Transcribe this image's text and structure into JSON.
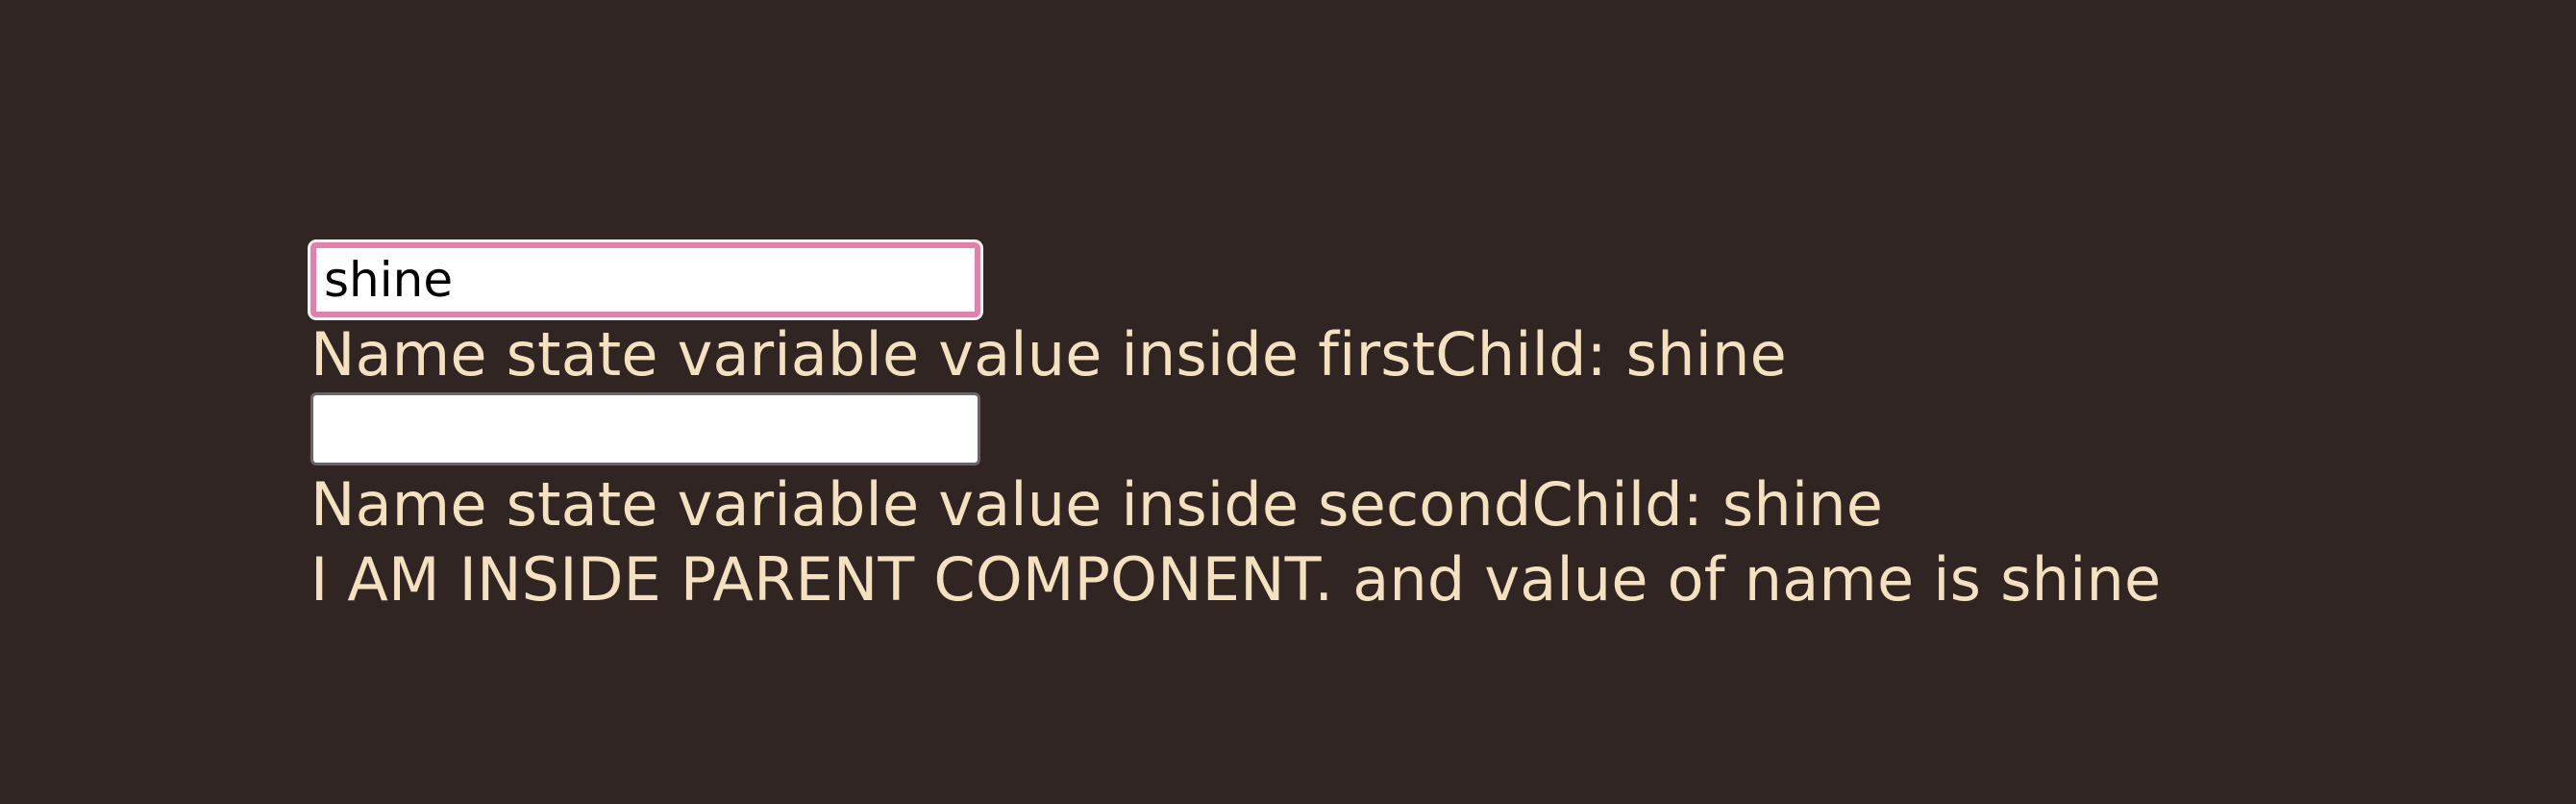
{
  "first_child": {
    "input_value": "shine",
    "label": "Name state variable value inside firstChild: shine"
  },
  "second_child": {
    "input_value": "",
    "label": "Name state variable value inside secondChild: shine"
  },
  "parent": {
    "label": "I AM INSIDE PARENT COMPONENT. and value of name is shine"
  },
  "colors": {
    "background": "#302523",
    "text": "#f4e1bf",
    "focus_border": "#e080ab"
  }
}
